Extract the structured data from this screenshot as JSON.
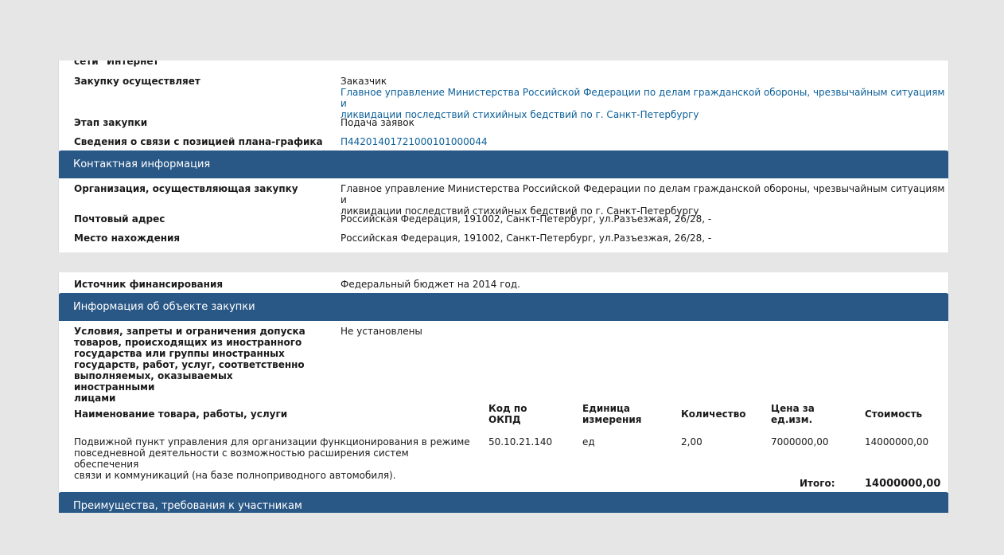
{
  "block1": {
    "cut_label": "сети \"Интернет\"",
    "purchaser_label": "Закупку осуществляет",
    "purchaser_role": "Заказчик",
    "purchaser_org_line1": "Главное управление Министерства Российской Федерации по делам гражданской обороны, чрезвычайным ситуациям и",
    "purchaser_org_line2": "ликвидации последствий стихийных бедствий по г. Санкт-Петербургу",
    "stage_label": "Этап закупки",
    "stage_value": "Подача заявок",
    "plan_label": "Сведения о связи с позицией плана-графика",
    "plan_value": "П44201401721000101000044"
  },
  "contact": {
    "section_title": "Контактная информация",
    "org_label": "Организация, осуществляющая закупку",
    "org_line1": "Главное управление Министерства Российской Федерации по делам гражданской обороны, чрезвычайным ситуациям и",
    "org_line2": "ликвидации последствий стихийных бедствий по г. Санкт-Петербургу",
    "postal_label": "Почтовый адрес",
    "postal_value": "Российская Федерация, 191002, Санкт-Петербург, ул.Разъезжая, 26/28, -",
    "location_label": "Место нахождения",
    "location_value": "Российская Федерация, 191002, Санкт-Петербург, ул.Разъезжая, 26/28, -"
  },
  "finance": {
    "label": "Источник финансирования",
    "value": "Федеральный бюджет на 2014 год."
  },
  "object": {
    "section_title": "Информация об объекте закупки",
    "conditions_label_lines": [
      "Условия, запреты и ограничения допуска",
      "товаров, происходящих из иностранного",
      "государства или группы иностранных",
      "государств, работ, услуг, соответственно",
      "выполняемых, оказываемых иностранными",
      "лицами"
    ],
    "conditions_value": "Не установлены",
    "table": {
      "col_name": "Наименование товара, работы, услуги",
      "col_okpd_1": "Код по",
      "col_okpd_2": "ОКПД",
      "col_unit_1": "Единица",
      "col_unit_2": "измерения",
      "col_qty": "Количество",
      "col_price_1": "Цена за",
      "col_price_2": "ед.изм.",
      "col_cost": "Стоимость",
      "row": {
        "name_lines": [
          "Подвижной пункт управления для организации функционирования в режиме",
          "повседневной деятельности с возможностью расширения систем обеспечения",
          "связи и коммуникаций (на базе полноприводного автомобиля)."
        ],
        "okpd": "50.10.21.140",
        "unit": "ед",
        "qty": "2,00",
        "price": "7000000,00",
        "cost": "14000000,00"
      },
      "total_label": "Итого:",
      "total_value": "14000000,00"
    }
  },
  "advantages": {
    "section_title": "Преимущества, требования к участникам"
  },
  "colors": {
    "section_header": "#2a5886",
    "link": "#0b5f98",
    "background": "#e6e6e6"
  }
}
